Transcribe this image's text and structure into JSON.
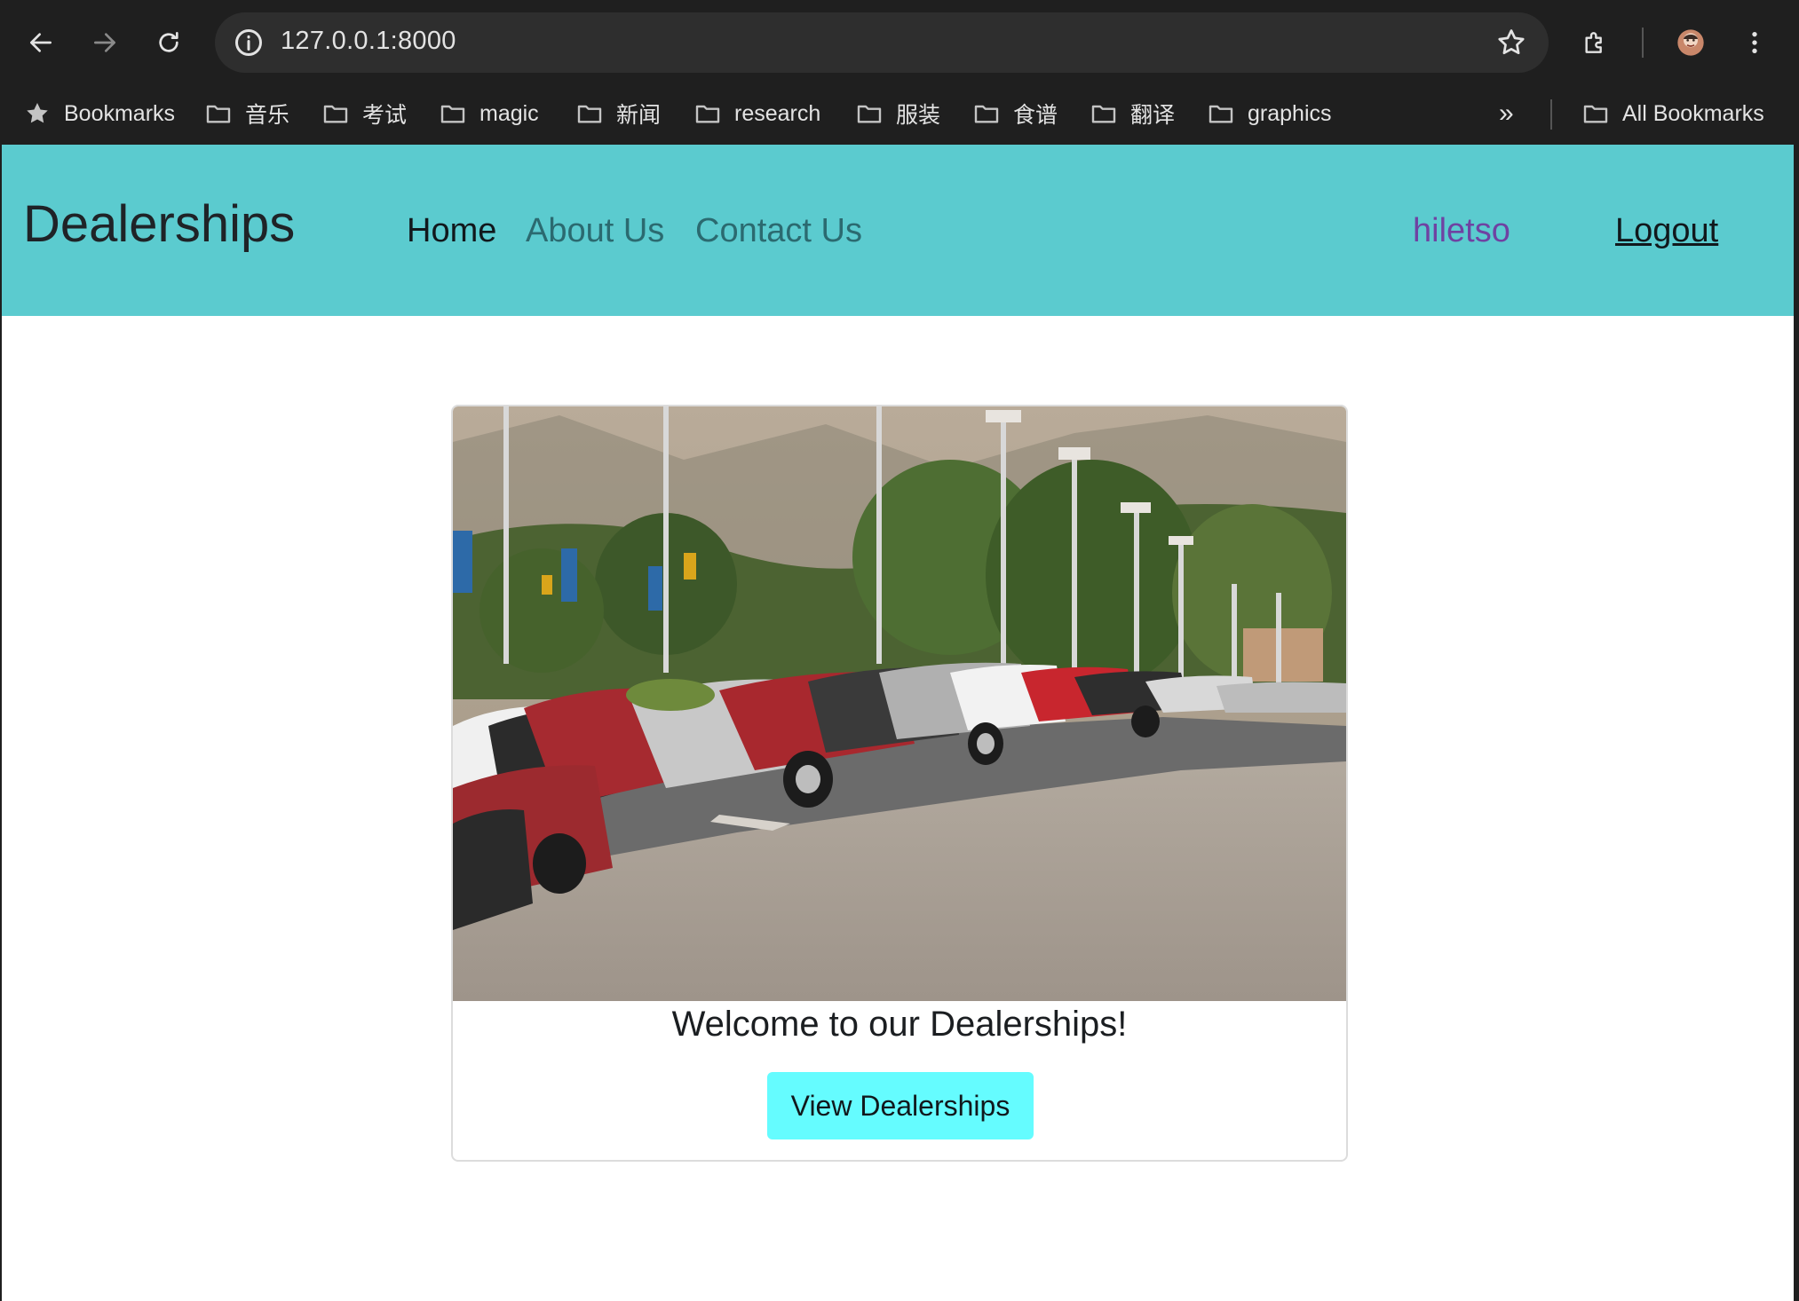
{
  "browser": {
    "url": "127.0.0.1:8000",
    "bookmarks": [
      {
        "label": "Bookmarks",
        "icon": "star-icon"
      },
      {
        "label": "音乐",
        "icon": "folder-icon"
      },
      {
        "label": "考试",
        "icon": "folder-icon"
      },
      {
        "label": "magic",
        "icon": "folder-icon"
      },
      {
        "label": "新闻",
        "icon": "folder-icon"
      },
      {
        "label": "research",
        "icon": "folder-icon"
      },
      {
        "label": "服装",
        "icon": "folder-icon"
      },
      {
        "label": "食谱",
        "icon": "folder-icon"
      },
      {
        "label": "翻译",
        "icon": "folder-icon"
      },
      {
        "label": "graphics",
        "icon": "folder-icon"
      }
    ],
    "overflow_label": "»",
    "all_bookmarks": "All Bookmarks"
  },
  "navbar": {
    "brand": "Dealerships",
    "links": [
      "Home",
      "About Us",
      "Contact Us"
    ],
    "username": "hiletso",
    "logout": "Logout",
    "background": "#5bcbcf"
  },
  "card": {
    "image_alt": "car dealership lot",
    "title": "Welcome to our Dealerships!",
    "button": "View Dealerships",
    "button_color": "#65fcff"
  }
}
